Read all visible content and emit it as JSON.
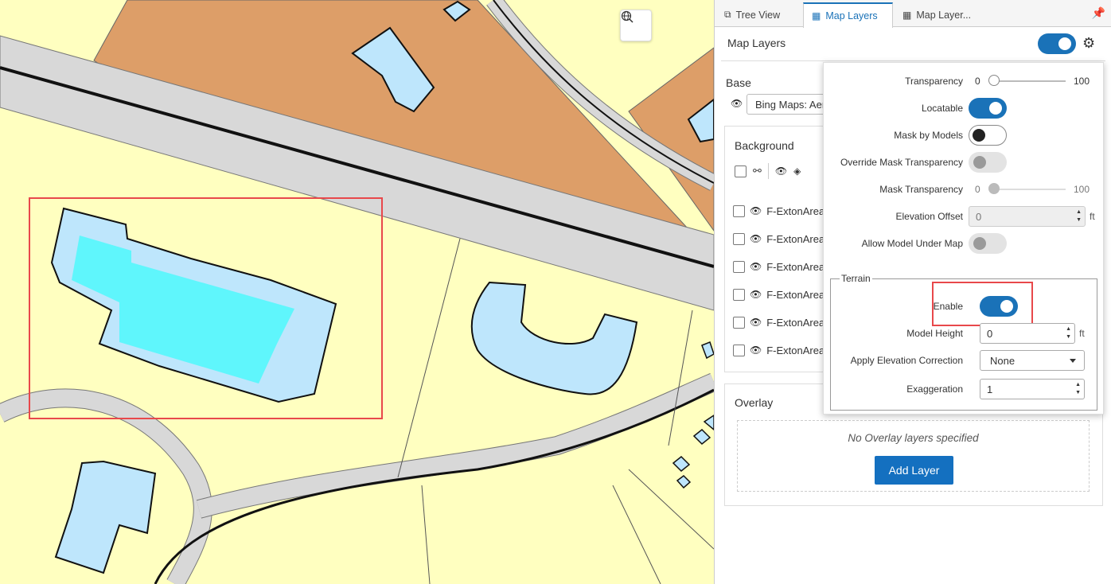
{
  "tabs": [
    {
      "label": "Tree View",
      "icon": "tree-icon"
    },
    {
      "label": "Map Layers",
      "icon": "map-layers-icon",
      "active": true
    },
    {
      "label": "Map Layer...",
      "icon": "map-layer-icon"
    }
  ],
  "header": {
    "title": "Map Layers",
    "toggle_on": true
  },
  "base": {
    "label": "Base",
    "select_value": "Bing Maps: Aerial"
  },
  "background": {
    "label": "Background",
    "layers": [
      "F-ExtonArea",
      "F-ExtonArea",
      "F-ExtonArea",
      "F-ExtonArea",
      "F-ExtonArea",
      "F-ExtonArea"
    ]
  },
  "overlay": {
    "label": "Overlay",
    "empty_text": "No Overlay layers specified",
    "add_button": "Add Layer"
  },
  "settings": {
    "transparency": {
      "label": "Transparency",
      "min": "0",
      "max": "100",
      "value": 0
    },
    "locatable": {
      "label": "Locatable",
      "on": true
    },
    "mask_by_models": {
      "label": "Mask by Models",
      "on": false
    },
    "override_mask_transparency": {
      "label": "Override Mask Transparency",
      "on": false
    },
    "mask_transparency": {
      "label": "Mask Transparency",
      "min": "0",
      "max": "100",
      "value": 0
    },
    "elevation_offset": {
      "label": "Elevation Offset",
      "value": "0",
      "unit": "ft"
    },
    "allow_model_under_map": {
      "label": "Allow Model Under Map",
      "on": false
    },
    "terrain": {
      "legend": "Terrain",
      "enable": {
        "label": "Enable",
        "on": true
      },
      "model_height": {
        "label": "Model Height",
        "value": "0",
        "unit": "ft"
      },
      "apply_elevation_correction": {
        "label": "Apply Elevation Correction",
        "value": "None"
      },
      "exaggeration": {
        "label": "Exaggeration",
        "value": "1"
      }
    }
  },
  "colors": {
    "accent": "#1a72b8",
    "highlight": "#e8484b",
    "map_land": "#ffffc0",
    "map_parcel": "#dd9e68",
    "map_building": "#bee6fc",
    "map_building_selected": "#5ff6fc",
    "map_road": "#d8d8d8"
  }
}
